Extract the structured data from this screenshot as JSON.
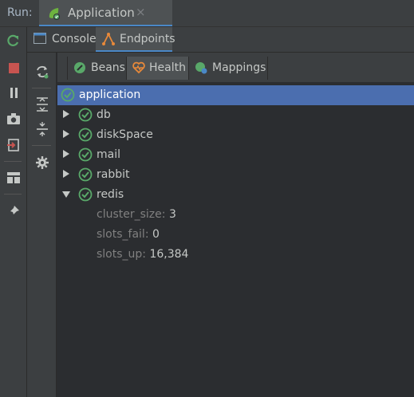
{
  "runbar": {
    "label": "Run:",
    "tab_title": "Application",
    "close": "×"
  },
  "left_toolbar": {
    "icons": [
      "rerun-icon",
      "stop-icon",
      "pause-icon",
      "camera-icon",
      "exit-icon",
      "layout-icon",
      "pin-icon"
    ],
    "colors": {
      "rerun": "#59a869",
      "stop": "#c75450"
    }
  },
  "subtabs": [
    {
      "label": "Console",
      "active": false
    },
    {
      "label": "Endpoints",
      "active": true
    }
  ],
  "second_toolbar": {
    "icons": [
      "refresh-icon",
      "expand-all-icon",
      "collapse-all-icon",
      "settings-icon"
    ]
  },
  "inner_tabs": [
    {
      "label": "Beans",
      "active": false
    },
    {
      "label": "Health",
      "active": true
    },
    {
      "label": "Mappings",
      "active": false
    }
  ],
  "tree": {
    "root": {
      "label": "application"
    },
    "children": [
      {
        "label": "db",
        "expanded": false
      },
      {
        "label": "diskSpace",
        "expanded": false
      },
      {
        "label": "mail",
        "expanded": false
      },
      {
        "label": "rabbit",
        "expanded": false
      },
      {
        "label": "redis",
        "expanded": true
      }
    ],
    "details": [
      {
        "key": "cluster_size:",
        "value": "3"
      },
      {
        "key": "slots_fail:",
        "value": "0"
      },
      {
        "key": "slots_up:",
        "value": "16,384"
      }
    ]
  },
  "colors": {
    "accent": "#4a88c7",
    "selection": "#4b6eaf",
    "ok": "#59a869",
    "health": "#e8893a"
  }
}
